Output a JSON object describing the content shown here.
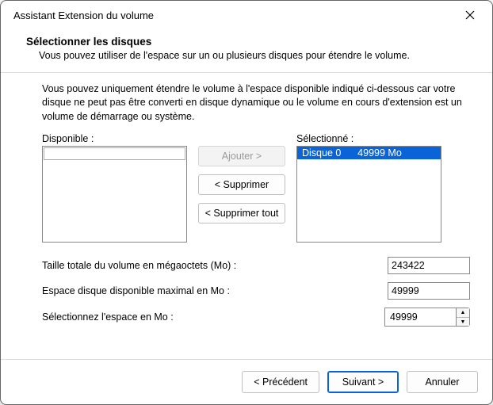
{
  "window": {
    "title": "Assistant Extension du volume"
  },
  "header": {
    "title": "Sélectionner les disques",
    "description": "Vous pouvez utiliser de l'espace sur un ou plusieurs disques pour étendre le volume."
  },
  "body": {
    "info_paragraph": "Vous pouvez uniquement étendre le volume à l'espace disponible indiqué ci-dessous car votre disque ne peut pas être converti en disque dynamique ou le volume en cours d'extension est un volume de démarrage ou système.",
    "available_label": "Disponible :",
    "selected_label": "Sélectionné :",
    "available_items": [],
    "selected_items": [
      {
        "text": "Disque 0      49999 Mo",
        "selected": true
      }
    ],
    "buttons": {
      "add": "Ajouter >",
      "remove": "< Supprimer",
      "remove_all": "< Supprimer tout"
    }
  },
  "form": {
    "total_label": "Taille totale du volume en mégaoctets (Mo) :",
    "total_value": "243422",
    "max_label": "Espace disque disponible maximal en Mo :",
    "max_value": "49999",
    "select_label": "Sélectionnez l'espace en Mo :",
    "select_value": "49999"
  },
  "footer": {
    "back": "< Précédent",
    "next": "Suivant >",
    "cancel": "Annuler"
  }
}
